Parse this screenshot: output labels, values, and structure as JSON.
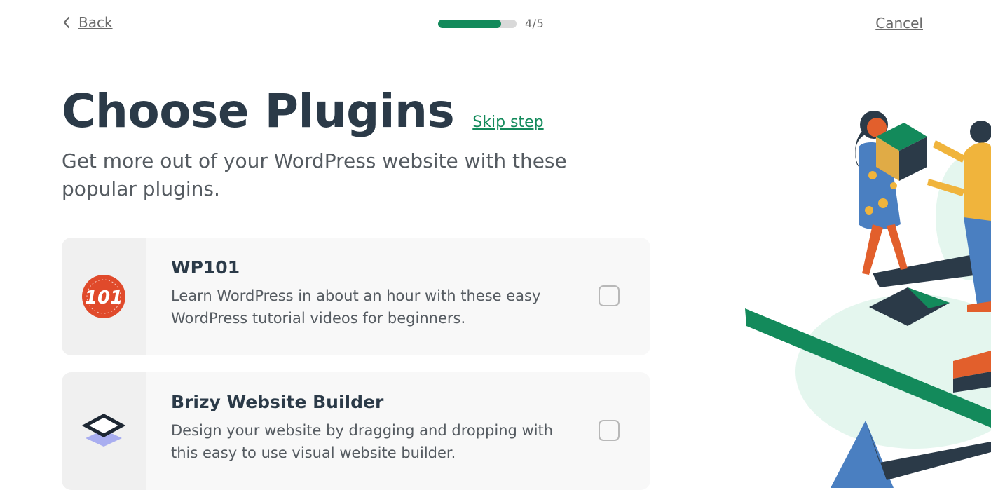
{
  "nav": {
    "back_label": "Back",
    "cancel_label": "Cancel",
    "progress_step": "4/5",
    "progress_fraction": 0.8
  },
  "header": {
    "title": "Choose Plugins",
    "skip_label": "Skip step",
    "subtitle": "Get more out of your WordPress website with these popular plugins."
  },
  "plugins": [
    {
      "name": "WP101",
      "description": "Learn WordPress in about an hour with these easy WordPress tutorial videos for beginners.",
      "logo_text": "101",
      "logo_icon": "wp101-logo-icon",
      "checked": false
    },
    {
      "name": "Brizy Website Builder",
      "description": "Design your website by dragging and dropping with this easy to use visual website builder.",
      "logo_icon": "brizy-logo-icon",
      "checked": false
    }
  ],
  "colors": {
    "accent": "#138a5b",
    "heading": "#2b3a48",
    "wp101_red": "#e04a2b",
    "brizy_dark": "#1d2733",
    "brizy_light": "#a9aef0"
  }
}
